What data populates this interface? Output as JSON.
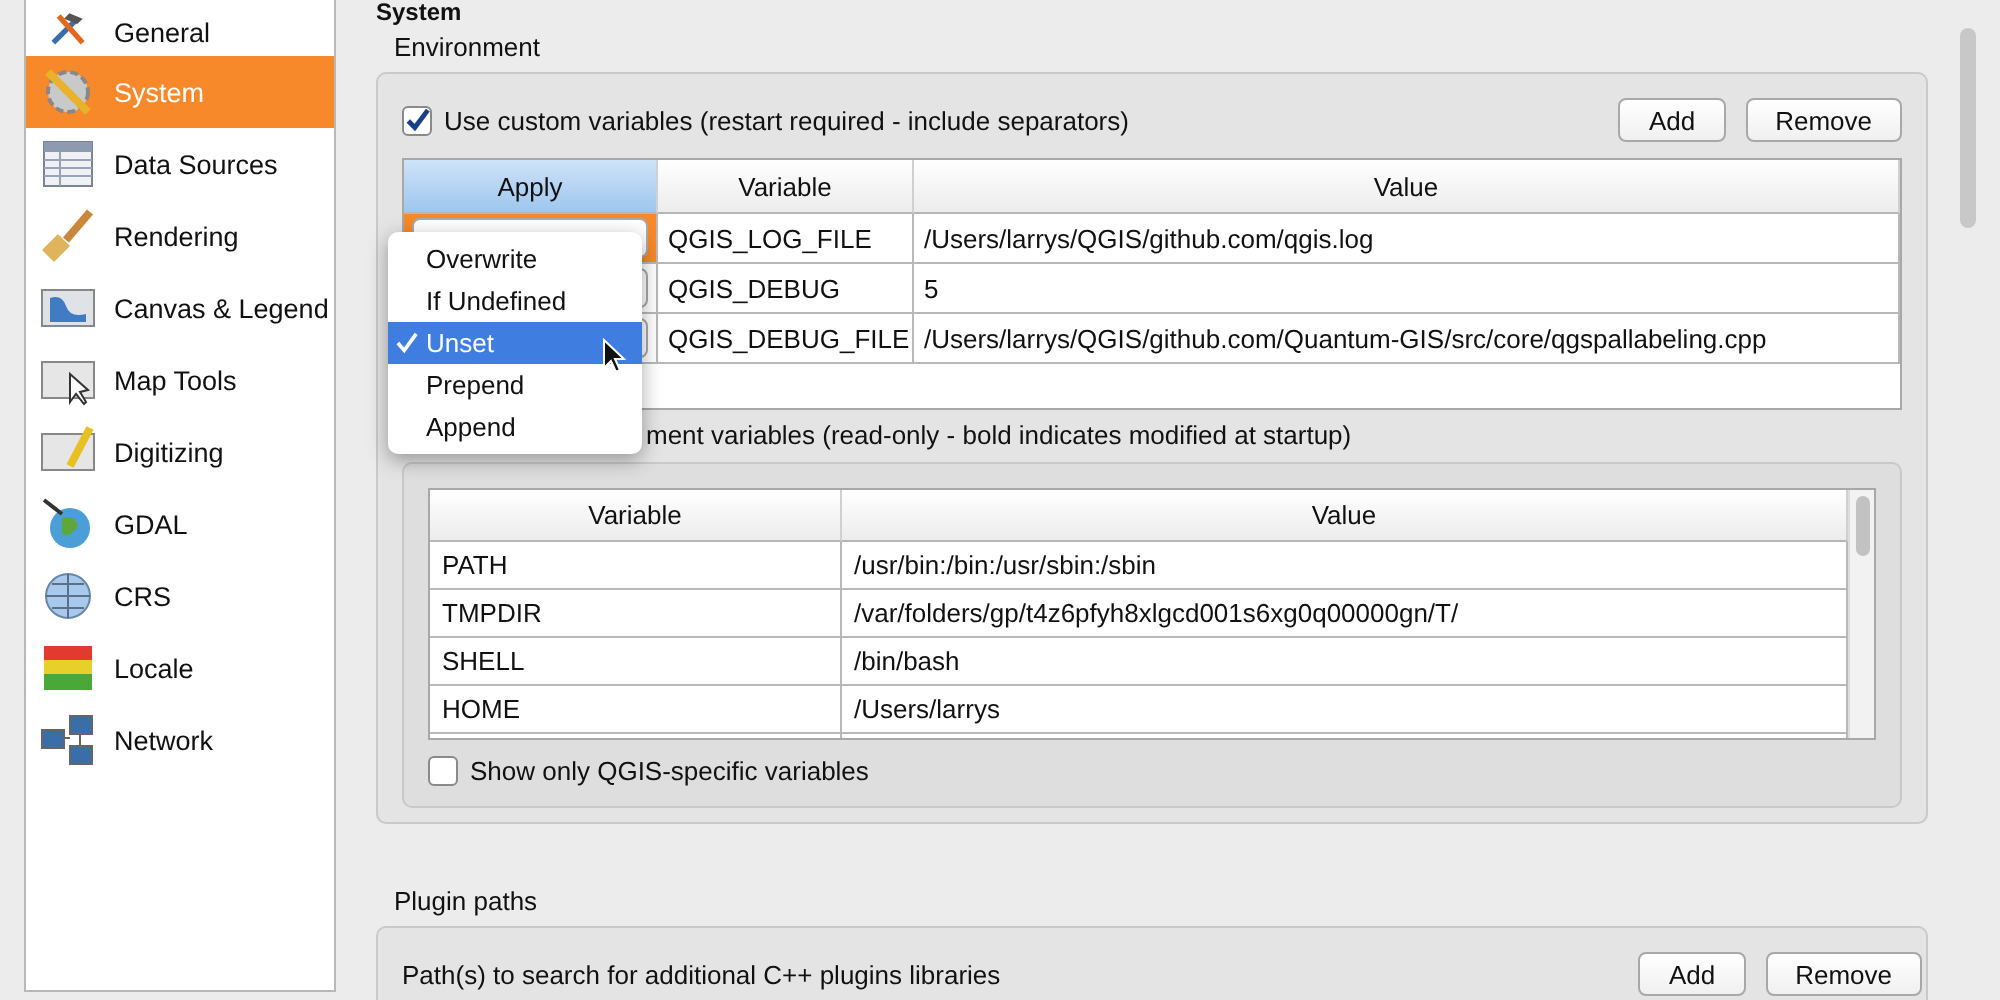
{
  "sidebar": {
    "items": [
      {
        "label": "General",
        "selected": false
      },
      {
        "label": "System",
        "selected": true
      },
      {
        "label": "Data Sources",
        "selected": false
      },
      {
        "label": "Rendering",
        "selected": false
      },
      {
        "label": "Canvas & Legend",
        "selected": false
      },
      {
        "label": "Map Tools",
        "selected": false
      },
      {
        "label": "Digitizing",
        "selected": false
      },
      {
        "label": "GDAL",
        "selected": false
      },
      {
        "label": "CRS",
        "selected": false
      },
      {
        "label": "Locale",
        "selected": false
      },
      {
        "label": "Network",
        "selected": false
      }
    ]
  },
  "page_title": "System",
  "environment": {
    "title": "Environment",
    "use_custom": {
      "label": "Use custom variables (restart required - include separators)",
      "checked": true
    },
    "buttons": [
      "Add",
      "Remove"
    ],
    "custom_table": {
      "columns": [
        "Apply",
        "Variable",
        "Value"
      ],
      "rows": [
        {
          "variable": "QGIS_LOG_FILE",
          "value": "/Users/larrys/QGIS/github.com/qgis.log",
          "selected": true
        },
        {
          "variable": "QGIS_DEBUG",
          "value": "5",
          "selected": false
        },
        {
          "variable": "QGIS_DEBUG_FILE",
          "value": "/Users/larrys/QGIS/github.com/Quantum-GIS/src/core/qgspallabeling.cpp",
          "selected": false
        }
      ]
    },
    "apply_menu": {
      "items": [
        {
          "label": "Overwrite",
          "selected": false
        },
        {
          "label": "If Undefined",
          "selected": false
        },
        {
          "label": "Unset",
          "selected": true
        },
        {
          "label": "Prepend",
          "selected": false
        },
        {
          "label": "Append",
          "selected": false
        }
      ]
    },
    "current_label": "ment variables (read-only - bold indicates modified at startup)",
    "current_table": {
      "columns": [
        "Variable",
        "Value"
      ],
      "rows": [
        {
          "variable": "PATH",
          "value": "/usr/bin:/bin:/usr/sbin:/sbin"
        },
        {
          "variable": "TMPDIR",
          "value": "/var/folders/gp/t4z6pfyh8xlgcd001s6xg0q00000gn/T/"
        },
        {
          "variable": "SHELL",
          "value": "/bin/bash"
        },
        {
          "variable": "HOME",
          "value": "/Users/larrys"
        }
      ]
    },
    "qgis_only": {
      "label": "Show only QGIS-specific variables",
      "checked": false
    }
  },
  "plugin_paths": {
    "title": "Plugin paths",
    "label": "Path(s) to search for additional C++ plugins libraries",
    "buttons": [
      "Add",
      "Remove"
    ]
  }
}
